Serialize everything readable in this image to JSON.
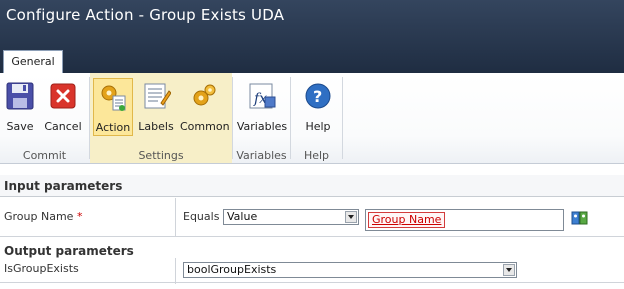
{
  "window": {
    "title": "Configure Action - Group Exists UDA"
  },
  "tabs": [
    {
      "label": "General"
    }
  ],
  "ribbon": {
    "buttons": {
      "save": "Save",
      "cancel": "Cancel",
      "action": "Action",
      "labels": "Labels",
      "common": "Common",
      "variables": "Variables",
      "help": "Help"
    },
    "groups": {
      "commit": "Commit",
      "settings": "Settings",
      "variables": "Variables",
      "help": "Help"
    }
  },
  "input_section": {
    "title": "Input parameters",
    "group_name": {
      "label": "Group Name",
      "required_mark": "*",
      "operator": "Equals",
      "type_value": "Value",
      "token": "Group Name"
    }
  },
  "output_section": {
    "title": "Output parameters",
    "is_group_exists": {
      "label": "IsGroupExists",
      "value": "boolGroupExists"
    }
  },
  "icons": {
    "save": "floppy-disk-icon",
    "cancel": "cancel-x-icon",
    "action": "action-gears-icon",
    "labels": "labels-notepad-icon",
    "common": "common-gears-icon",
    "variables": "fx-variables-icon",
    "help": "help-question-icon",
    "lookup": "address-book-lookup-icon"
  }
}
